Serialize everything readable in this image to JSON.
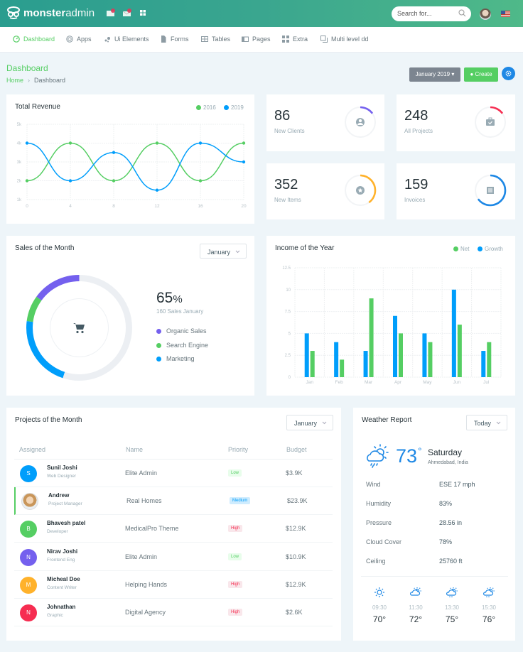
{
  "topbar": {
    "logo_bold": "monster",
    "logo_light": "admin",
    "search_placeholder": "Search for...",
    "icons": [
      "message-icon",
      "email-icon",
      "apps-grid-icon"
    ]
  },
  "nav": {
    "items": [
      {
        "label": "Dashboard",
        "icon": "gauge-icon",
        "active": true
      },
      {
        "label": "Apps",
        "icon": "target-icon"
      },
      {
        "label": "Ui Elements",
        "icon": "bubbles-icon"
      },
      {
        "label": "Forms",
        "icon": "file-icon"
      },
      {
        "label": "Tables",
        "icon": "table-icon"
      },
      {
        "label": "Pages",
        "icon": "pages-icon"
      },
      {
        "label": "Extra",
        "icon": "widgets-icon"
      },
      {
        "label": "Multi level dd",
        "icon": "layers-icon"
      }
    ]
  },
  "page": {
    "title": "Dashboard",
    "breadcrumb": [
      "Home",
      "Dashboard"
    ],
    "month_button": "January 2019",
    "create_button": "Create"
  },
  "stats": [
    {
      "value": "86",
      "label": "New Clients",
      "icon": "account-icon",
      "color": "#7460ee",
      "progress": 0.15
    },
    {
      "value": "248",
      "label": "All Projects",
      "icon": "briefcase-check-icon",
      "color": "#f62d51",
      "progress": 0.15
    },
    {
      "value": "352",
      "label": "New Items",
      "icon": "star-icon",
      "color": "#ffb22b",
      "progress": 0.4
    },
    {
      "value": "159",
      "label": "Invoices",
      "icon": "receipt-icon",
      "color": "#1e88e5",
      "progress": 0.65
    }
  ],
  "sales": {
    "title": "Sales of the Month",
    "select": "January",
    "percent": "65",
    "percent_sign": "%",
    "subtitle": "160 Sales January",
    "legend": [
      {
        "label": "Organic Sales",
        "color": "#7460ee"
      },
      {
        "label": "Search Engine",
        "color": "#55ce63"
      },
      {
        "label": "Marketing",
        "color": "#009efb"
      }
    ]
  },
  "projects": {
    "title": "Projects of the Month",
    "select": "January",
    "columns": [
      "Assigned",
      "Name",
      "Priority",
      "Budget"
    ],
    "rows": [
      {
        "initial": "S",
        "color": "#009efb",
        "name": "Sunil Joshi",
        "role": "Web Designer",
        "project": "Elite Admin",
        "priority": "Low",
        "budget": "$3.9K"
      },
      {
        "initial": "",
        "color": "photo",
        "name": "Andrew",
        "role": "Project Manager",
        "project": "Real Homes",
        "priority": "Medium",
        "budget": "$23.9K"
      },
      {
        "initial": "B",
        "color": "#55ce63",
        "name": "Bhavesh patel",
        "role": "Developer",
        "project": "MedicalPro Theme",
        "priority": "High",
        "budget": "$12.9K"
      },
      {
        "initial": "N",
        "color": "#7460ee",
        "name": "Nirav Joshi",
        "role": "Frontend Eng",
        "project": "Elite Admin",
        "priority": "Low",
        "budget": "$10.9K"
      },
      {
        "initial": "M",
        "color": "#ffb22b",
        "name": "Micheal Doe",
        "role": "Content Writer",
        "project": "Helping Hands",
        "priority": "High",
        "budget": "$12.9K"
      },
      {
        "initial": "N",
        "color": "#f62d51",
        "name": "Johnathan",
        "role": "Graphic",
        "project": "Digital Agency",
        "priority": "High",
        "budget": "$2.6K"
      }
    ]
  },
  "weather": {
    "title": "Weather Report",
    "select": "Today",
    "temp": "73",
    "deg": "°",
    "day": "Saturday",
    "location": "Ahmedabad, India",
    "details": [
      {
        "label": "Wind",
        "value": "ESE 17 mph"
      },
      {
        "label": "Humidity",
        "value": "83%"
      },
      {
        "label": "Pressure",
        "value": "28.56 in"
      },
      {
        "label": "Cloud Cover",
        "value": "78%"
      },
      {
        "label": "Ceiling",
        "value": "25760 ft"
      }
    ],
    "forecast": [
      {
        "time": "09:30",
        "temp": "70°",
        "icon": "sun-icon"
      },
      {
        "time": "11:30",
        "temp": "72°",
        "icon": "partly-cloudy-icon"
      },
      {
        "time": "13:30",
        "temp": "75°",
        "icon": "cloud-rain-sun-icon"
      },
      {
        "time": "15:30",
        "temp": "76°",
        "icon": "cloud-drizzle-sun-icon"
      }
    ]
  },
  "chart_data": [
    {
      "type": "line",
      "title": "Total Revenue",
      "x": [
        0,
        4,
        8,
        12,
        16,
        20
      ],
      "series": [
        {
          "name": "2016",
          "color": "#55ce63",
          "values": [
            2,
            4,
            2,
            4,
            2,
            4
          ]
        },
        {
          "name": "2019",
          "color": "#009efb",
          "values": [
            4,
            2,
            3.5,
            1.5,
            4,
            3
          ]
        }
      ],
      "ylim": [
        1,
        5
      ],
      "yticks": [
        "5k",
        "4k",
        "3k",
        "2k",
        "1k"
      ],
      "xticks": [
        "0",
        "4",
        "8",
        "12",
        "16",
        "20"
      ],
      "grid": true,
      "legend": "top-right"
    },
    {
      "type": "bar",
      "title": "Income of the Year",
      "categories": [
        "Jan",
        "Feb",
        "Mar",
        "Apr",
        "May",
        "Jun",
        "Jul"
      ],
      "series": [
        {
          "name": "Growth",
          "color": "#009efb",
          "values": [
            5,
            4,
            3,
            7,
            5,
            10,
            3
          ]
        },
        {
          "name": "Net",
          "color": "#55ce63",
          "values": [
            3,
            2,
            9,
            5,
            4,
            6,
            4
          ]
        }
      ],
      "legend_order": [
        "Net",
        "Growth"
      ],
      "ylim": [
        0,
        12.5
      ],
      "yticks": [
        "0",
        "2.5",
        "5",
        "7.5",
        "10",
        "12.5"
      ],
      "grid": true,
      "legend": "top-right"
    },
    {
      "type": "pie",
      "title": "Sales of the Month",
      "labels": [
        "Organic Sales",
        "Search Engine",
        "Marketing",
        "Remaining"
      ],
      "values": [
        15,
        8,
        22,
        55
      ],
      "colors": [
        "#7460ee",
        "#55ce63",
        "#009efb",
        "#eceff3"
      ]
    }
  ]
}
